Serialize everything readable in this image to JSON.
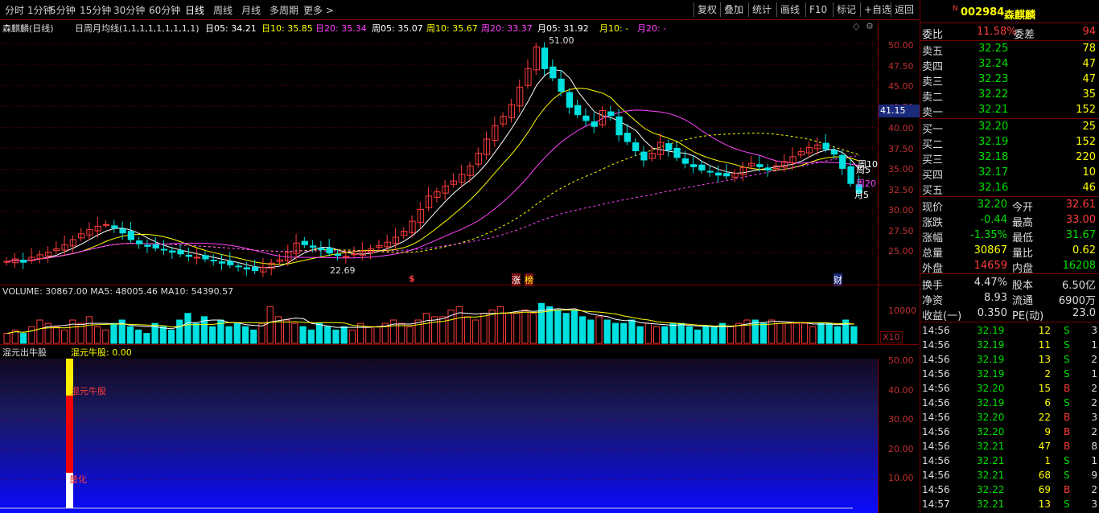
{
  "toolbar": {
    "periods": [
      "分时",
      "1分钟",
      "5分钟",
      "15分钟",
      "30分钟",
      "60分钟",
      "日线",
      "周线",
      "月线",
      "多周期",
      "更多 >"
    ],
    "active_period": "日线",
    "right_buttons": [
      "复权",
      "叠加",
      "统计",
      "画线",
      "F10",
      "标记",
      "+自选",
      "返回"
    ]
  },
  "chart_info": {
    "stock_label": "森麒麟(日线)",
    "indicator_label": "日周月均线(1,1,1,1,1,1,1,1,1)",
    "ma_day5": "日05: 34.21",
    "ma_day10": "日10: 35.85",
    "ma_day20": "日20: 35.34",
    "ma_week5": "周05: 35.07",
    "ma_week10": "周10: 35.67",
    "ma_week20": "周20: 33.37",
    "ma_month5": "月05: 31.92",
    "ma_month10": "月10: -",
    "ma_month20": "月20: -",
    "high_marker": "51.00",
    "low_marker": "22.69",
    "price_tag": "41.15",
    "ma_right_labels": [
      "周10",
      "周5",
      "周20",
      "月5"
    ],
    "event_markers": [
      "$",
      "涨",
      "榜",
      "财"
    ],
    "price_axis": [
      "50.00",
      "47.50",
      "45.00",
      "42.50",
      "40.00",
      "37.50",
      "35.00",
      "32.50",
      "30.00",
      "27.50",
      "25.00"
    ]
  },
  "chart_data": [
    {
      "type": "candlestick",
      "title": "森麒麟(日线)",
      "ylim": [
        22.0,
        52.5
      ],
      "close_path": [
        24.0,
        24.3,
        23.9,
        24.5,
        24.8,
        25.1,
        25.5,
        26.0,
        26.6,
        27.3,
        27.8,
        28.2,
        28.4,
        28.0,
        27.4,
        26.6,
        26.1,
        25.8,
        25.6,
        25.4,
        25.1,
        24.9,
        24.6,
        24.5,
        24.3,
        24.1,
        23.8,
        23.6,
        23.4,
        23.1,
        22.9,
        23.3,
        23.8,
        24.2,
        25.1,
        26.2,
        26.0,
        25.7,
        25.4,
        25.0,
        24.7,
        24.6,
        24.9,
        25.2,
        25.5,
        25.9,
        26.3,
        26.9,
        27.6,
        28.8,
        30.2,
        31.8,
        32.3,
        33.0,
        33.6,
        34.4,
        35.4,
        36.9,
        38.6,
        40.2,
        41.3,
        42.7,
        44.8,
        47.0,
        49.6,
        47.0,
        45.9,
        44.3,
        42.4,
        41.5,
        40.8,
        40.1,
        42.0,
        41.4,
        39.1,
        38.3,
        37.2,
        36.1,
        36.9,
        38.2,
        37.3,
        36.4,
        35.7,
        35.3,
        34.9,
        34.7,
        34.3,
        34.2,
        34.5,
        35.2,
        35.7,
        35.3,
        34.9,
        35.4,
        35.9,
        36.5,
        37.1,
        37.6,
        37.9,
        37.4,
        36.8,
        35.1,
        33.3,
        32.2
      ]
    },
    {
      "type": "bar",
      "title": "VOLUME",
      "annotation": "VOLUME: 30867.00  MA5: 48005.46  MA10: 54390.57",
      "tick_label": "10000",
      "unit_tag": "X10",
      "values": [
        3,
        4,
        3,
        5,
        7,
        6,
        5,
        4,
        7,
        6,
        8,
        5,
        4,
        6,
        7,
        5,
        4,
        3,
        6,
        5,
        4,
        7,
        9,
        6,
        8,
        5,
        7,
        5,
        6,
        5,
        4,
        6,
        11,
        8,
        7,
        6,
        5,
        4,
        6,
        5,
        4,
        5,
        4,
        6,
        5,
        5,
        6,
        7,
        6,
        5,
        7,
        9,
        8,
        8,
        10,
        11,
        8,
        7,
        9,
        10,
        11,
        9,
        9,
        10,
        9,
        12,
        11,
        10,
        9,
        10,
        8,
        7,
        8,
        7,
        6,
        6,
        7,
        5,
        6,
        5,
        5,
        6,
        6,
        5,
        4,
        5,
        5,
        6,
        5,
        6,
        7,
        7,
        6,
        7,
        6,
        6,
        6,
        6,
        5,
        6,
        6,
        5,
        7,
        5
      ],
      "ylim": [
        0,
        14
      ]
    },
    {
      "type": "bar",
      "title": "混元出牛股",
      "annotation": "混元牛股: 0.00",
      "bar_labels": [
        "混元牛股",
        "量化"
      ],
      "y_ticks": [
        "50.00",
        "40.00",
        "30.00",
        "20.00",
        "10.00"
      ],
      "ylim": [
        0,
        55
      ]
    }
  ],
  "quote": {
    "code": "002984",
    "name": "森麒麟",
    "weibi_label": "委比",
    "weibi": "11.58%",
    "weicha_label": "委差",
    "weicha": "94",
    "asks": [
      {
        "label": "卖五",
        "price": "32.25",
        "vol": "78"
      },
      {
        "label": "卖四",
        "price": "32.24",
        "vol": "47"
      },
      {
        "label": "卖三",
        "price": "32.23",
        "vol": "47"
      },
      {
        "label": "卖二",
        "price": "32.22",
        "vol": "35"
      },
      {
        "label": "卖一",
        "price": "32.21",
        "vol": "152"
      }
    ],
    "bids": [
      {
        "label": "买一",
        "price": "32.20",
        "vol": "25"
      },
      {
        "label": "买二",
        "price": "32.19",
        "vol": "152"
      },
      {
        "label": "买三",
        "price": "32.18",
        "vol": "220"
      },
      {
        "label": "买四",
        "price": "32.17",
        "vol": "10"
      },
      {
        "label": "买五",
        "price": "32.16",
        "vol": "46"
      }
    ],
    "stats": [
      {
        "l1": "现价",
        "v1": "32.20",
        "l2": "今开",
        "v2": "32.61",
        "c1": "g",
        "c2": "r"
      },
      {
        "l1": "涨跌",
        "v1": "-0.44",
        "l2": "最高",
        "v2": "33.00",
        "c1": "g",
        "c2": "r"
      },
      {
        "l1": "涨幅",
        "v1": "-1.35%",
        "l2": "最低",
        "v2": "31.67",
        "c1": "g",
        "c2": "g"
      },
      {
        "l1": "总量",
        "v1": "30867",
        "l2": "量比",
        "v2": "0.62",
        "c1": "y",
        "c2": "y"
      },
      {
        "l1": "外盘",
        "v1": "14659",
        "l2": "内盘",
        "v2": "16208",
        "c1": "r",
        "c2": "g"
      }
    ],
    "stats2": [
      {
        "l1": "换手",
        "v1": "4.47%",
        "l2": "股本",
        "v2": "6.50亿"
      },
      {
        "l1": "净资",
        "v1": "8.93",
        "l2": "流通",
        "v2": "6900万"
      },
      {
        "l1": "收益(一)",
        "v1": "0.350",
        "l2": "PE(动)",
        "v2": "23.0"
      }
    ],
    "ticks": [
      {
        "t": "14:56",
        "p": "32.19",
        "v": "12",
        "s": "S",
        "n": "3"
      },
      {
        "t": "14:56",
        "p": "32.19",
        "v": "11",
        "s": "S",
        "n": "1"
      },
      {
        "t": "14:56",
        "p": "32.19",
        "v": "13",
        "s": "S",
        "n": "2"
      },
      {
        "t": "14:56",
        "p": "32.19",
        "v": "2",
        "s": "S",
        "n": "1"
      },
      {
        "t": "14:56",
        "p": "32.20",
        "v": "15",
        "s": "B",
        "n": "2"
      },
      {
        "t": "14:56",
        "p": "32.19",
        "v": "6",
        "s": "S",
        "n": "2"
      },
      {
        "t": "14:56",
        "p": "32.20",
        "v": "22",
        "s": "B",
        "n": "3"
      },
      {
        "t": "14:56",
        "p": "32.20",
        "v": "9",
        "s": "B",
        "n": "2"
      },
      {
        "t": "14:56",
        "p": "32.21",
        "v": "47",
        "s": "B",
        "n": "8"
      },
      {
        "t": "14:56",
        "p": "32.21",
        "v": "1",
        "s": "S",
        "n": "1"
      },
      {
        "t": "14:56",
        "p": "32.21",
        "v": "68",
        "s": "S",
        "n": "9"
      },
      {
        "t": "14:56",
        "p": "32.22",
        "v": "69",
        "s": "B",
        "n": "2"
      },
      {
        "t": "14:57",
        "p": "32.21",
        "v": "13",
        "s": "S",
        "n": "3"
      }
    ]
  },
  "colors": {
    "up": "#ff3b3b",
    "down": "#00e0e0",
    "grid": "#7a0000",
    "ma5": "#ffffff",
    "ma10": "#ffff00",
    "ma20": "#ff44ff"
  }
}
